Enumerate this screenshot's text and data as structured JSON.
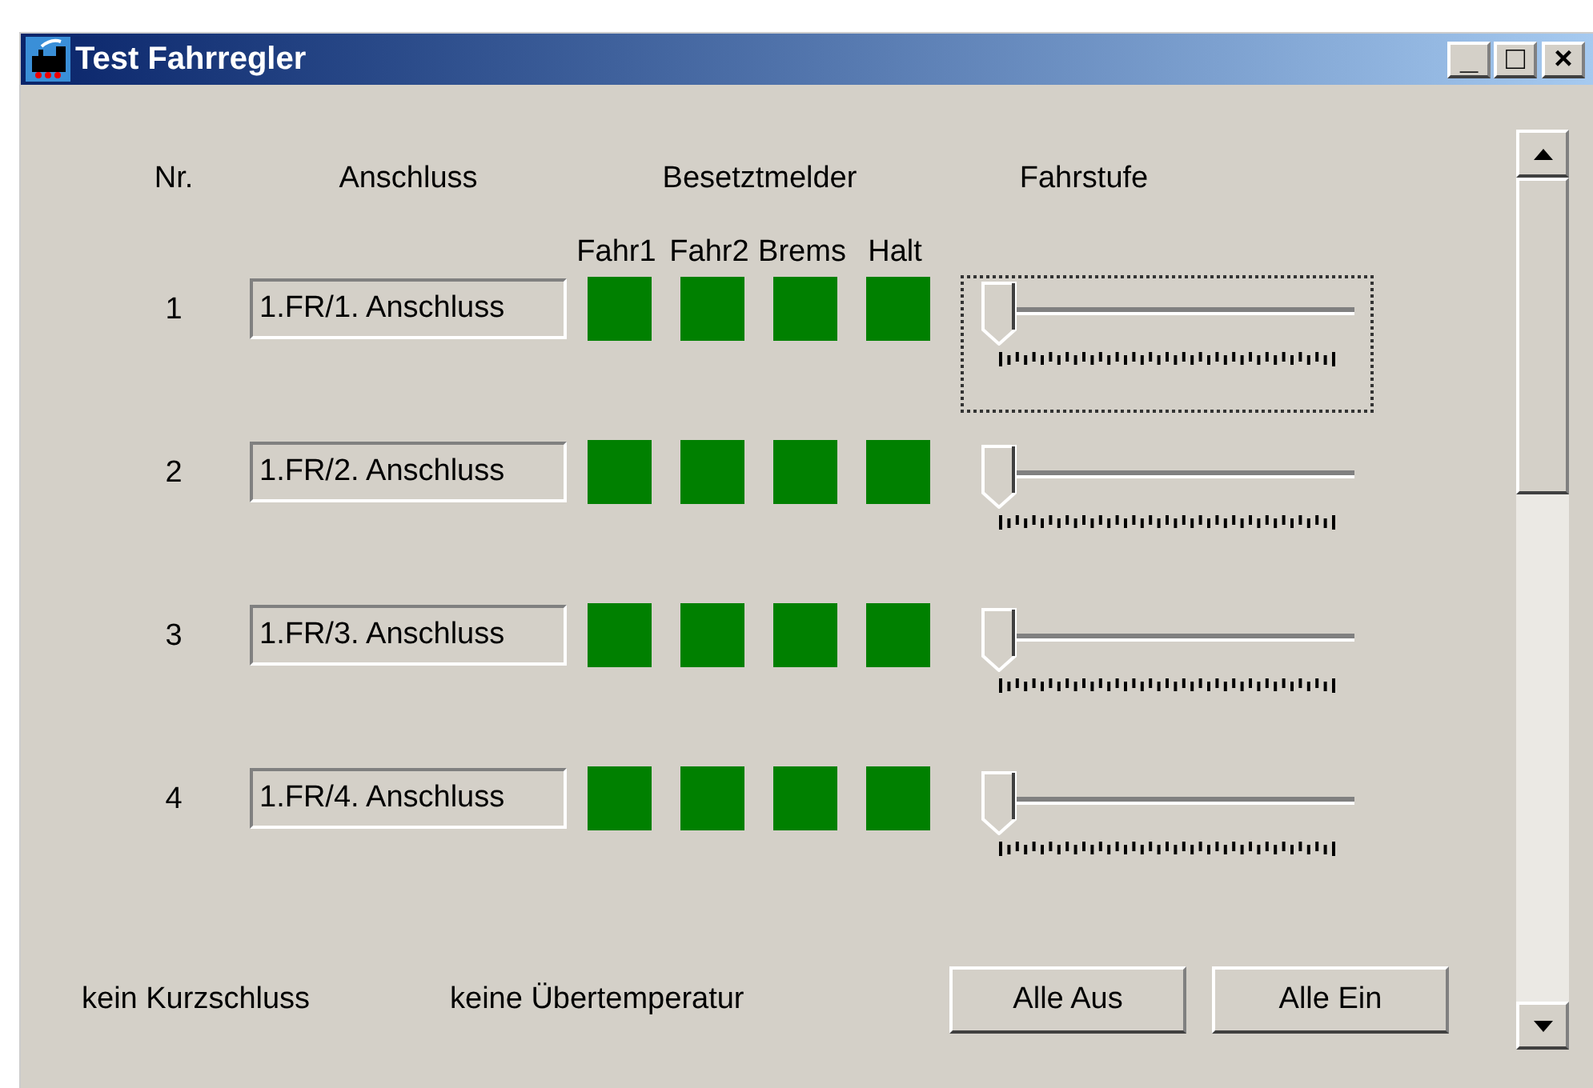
{
  "window": {
    "title": "Test Fahrregler",
    "controls": [
      "_",
      "□",
      "×"
    ]
  },
  "headers": {
    "number": "Nr.",
    "connection": "Anschluss",
    "detectors": "Besetztmelder",
    "speed_step": "Fahrstufe"
  },
  "detector_labels": [
    "Fahr1",
    "Fahr2",
    "Brems",
    "Halt"
  ],
  "rows": [
    {
      "number": "1",
      "connection": "1.FR/1. Anschluss",
      "detectors": [
        {
          "on": true
        },
        {
          "on": true
        },
        {
          "on": true
        },
        {
          "on": true
        }
      ],
      "slider": {
        "level": 0,
        "focused": true
      }
    },
    {
      "number": "2",
      "connection": "1.FR/2. Anschluss",
      "detectors": [
        {
          "on": true
        },
        {
          "on": true
        },
        {
          "on": true
        },
        {
          "on": true
        }
      ],
      "slider": {
        "level": 0,
        "focused": false
      }
    },
    {
      "number": "3",
      "connection": "1.FR/3. Anschluss",
      "detectors": [
        {
          "on": true
        },
        {
          "on": true
        },
        {
          "on": true
        },
        {
          "on": true
        }
      ],
      "slider": {
        "level": 0,
        "focused": false
      }
    },
    {
      "number": "4",
      "connection": "1.FR/4. Anschluss",
      "detectors": [
        {
          "on": true
        },
        {
          "on": true
        },
        {
          "on": true
        },
        {
          "on": true
        }
      ],
      "slider": {
        "level": 0,
        "focused": false
      }
    }
  ],
  "status": {
    "short_circuit": "kein Kurzschluss",
    "temperature": "keine Übertemperatur"
  },
  "buttons": [
    "Alle Aus",
    "Alle Ein"
  ]
}
